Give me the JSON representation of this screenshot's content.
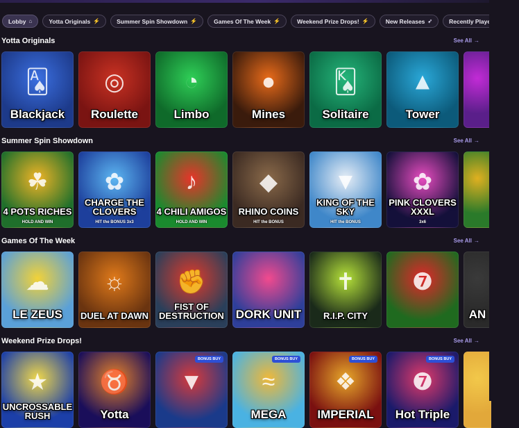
{
  "tabs": [
    {
      "label": "Lobby",
      "icon": "home-icon",
      "glyph": "⌂",
      "active": true
    },
    {
      "label": "Yotta Originals",
      "icon": "bolt-icon",
      "glyph": "⚡"
    },
    {
      "label": "Summer Spin Showdown",
      "icon": "bolt-icon",
      "glyph": "⚡"
    },
    {
      "label": "Games Of The Week",
      "icon": "bolt-icon",
      "glyph": "⚡"
    },
    {
      "label": "Weekend Prize Drops!",
      "icon": "bolt-icon",
      "glyph": "⚡"
    },
    {
      "label": "New Releases",
      "icon": "rocket-icon",
      "glyph": "➶"
    },
    {
      "label": "Recently Played",
      "icon": "clock-icon",
      "glyph": "▣"
    }
  ],
  "see_all_label": "See All",
  "sections": [
    {
      "title": "Yotta Originals",
      "cards": [
        {
          "caption": "Blackjack",
          "bg": "#1d3a8a",
          "art": "🂡",
          "accent": "#3b6fe0"
        },
        {
          "caption": "Roulette",
          "bg": "#7a1412",
          "art": "◎",
          "accent": "#c93223"
        },
        {
          "caption": "Limbo",
          "bg": "#0f6a2a",
          "art": "◔",
          "accent": "#2fcf57"
        },
        {
          "caption": "Mines",
          "bg": "#3a1b0c",
          "art": "●",
          "accent": "#e86b1a"
        },
        {
          "caption": "Solitaire",
          "bg": "#0b6b45",
          "art": "🂮",
          "accent": "#25b57a"
        },
        {
          "caption": "Tower",
          "bg": "#0c5a7a",
          "art": "▲",
          "accent": "#2aa8d8"
        },
        {
          "caption": "",
          "bg": "#5a1f8a",
          "art": "",
          "accent": "#c22bd6",
          "clip": true
        }
      ]
    },
    {
      "title": "Summer Spin Showdown",
      "cards": [
        {
          "caption": "4 POTS RICHES",
          "sub": "HOLD AND WIN",
          "bg": "#1f6f2b",
          "art": "☘",
          "accent": "#f0b426"
        },
        {
          "caption": "CHARGE THE CLOVERS",
          "sub": "HIT the BONUS 3x3",
          "bg": "#1d3f9c",
          "art": "✿",
          "accent": "#5db7f2"
        },
        {
          "caption": "4 CHILI AMIGOS",
          "sub": "HOLD AND WIN",
          "bg": "#1a8a2e",
          "art": "♪",
          "accent": "#e8342a"
        },
        {
          "caption": "RHINO COINS",
          "sub": "HIT the BONUS",
          "bg": "#3b2a22",
          "art": "◆",
          "accent": "#8a6a4a"
        },
        {
          "caption": "KING OF THE SKY",
          "sub": "HIT the BONUS",
          "bg": "#3f87c9",
          "art": "▼",
          "accent": "#e7eef6"
        },
        {
          "caption": "PINK CLOVERS XXXL",
          "sub": "3x6",
          "bg": "#14103a",
          "art": "✿",
          "accent": "#e84cc0"
        },
        {
          "caption": "",
          "bg": "#2a7a2a",
          "art": "",
          "accent": "#e0b020",
          "clip": true
        }
      ]
    },
    {
      "title": "Games Of The Week",
      "cards": [
        {
          "caption": "LE ZEUS",
          "bg": "#5aa0d8",
          "art": "☁",
          "accent": "#f2d238"
        },
        {
          "caption": "DUEL AT DAWN",
          "bg": "#6a3410",
          "art": "☼",
          "accent": "#e07a1a"
        },
        {
          "caption": "FIST OF DESTRUCTION",
          "bg": "#2a3f5a",
          "art": "✊",
          "accent": "#e03b2a"
        },
        {
          "caption": "DORK UNIT",
          "bg": "#2e3f9a",
          "art": "",
          "accent": "#f24a8e"
        },
        {
          "caption": "R.I.P. CITY",
          "bg": "#1a2a1a",
          "art": "✝",
          "accent": "#b6e23a"
        },
        {
          "caption": "",
          "bg": "#1f6a1f",
          "art": "❼",
          "accent": "#e2262a"
        },
        {
          "caption": "AN",
          "bg": "#2a2a2a",
          "art": "",
          "accent": "#3a3a3a",
          "clip": true
        }
      ]
    },
    {
      "title": "Weekend Prize Drops!",
      "cards": [
        {
          "caption": "UNCROSSABLE RUSH",
          "bg": "#1c3fa8",
          "art": "★",
          "accent": "#f0d84a"
        },
        {
          "caption": "Yotta",
          "bg": "#1a0e5a",
          "art": "♉",
          "accent": "#e8842a"
        },
        {
          "caption": "",
          "badge": "BONUS BUY",
          "bg": "#1a3a8a",
          "art": "▼",
          "accent": "#d83a3a"
        },
        {
          "caption": "MEGA",
          "badge": "BONUS BUY",
          "bg": "#4ab2e2",
          "art": "≈",
          "accent": "#f0b838"
        },
        {
          "caption": "IMPERIAL",
          "badge": "BONUS BUY",
          "bg": "#7a1010",
          "art": "❖",
          "accent": "#e8a82a"
        },
        {
          "caption": "Hot Triple",
          "badge": "BONUS BUY",
          "bg": "#1a1a6a",
          "art": "❼",
          "accent": "#e23a6a"
        },
        {
          "caption": "",
          "bg": "#e2a83a",
          "art": "",
          "accent": "#f2c84a",
          "clip": true
        }
      ]
    }
  ]
}
